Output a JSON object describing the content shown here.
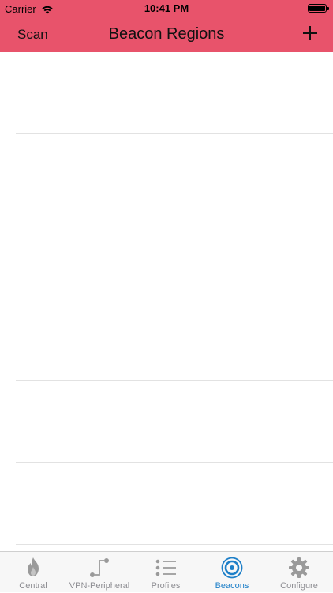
{
  "status_bar": {
    "carrier": "Carrier",
    "time": "10:41 PM"
  },
  "nav": {
    "left_label": "Scan",
    "title": "Beacon Regions",
    "right_icon": "plus-icon"
  },
  "colors": {
    "header": "#e8536b",
    "tab_active": "#1d7fc8",
    "tab_inactive": "#8e8e93"
  },
  "table": {
    "row_count": 6
  },
  "tabs": [
    {
      "label": "Central",
      "icon": "flame-icon",
      "active": false
    },
    {
      "label": "VPN-Peripheral",
      "icon": "peripheral-icon",
      "active": false
    },
    {
      "label": "Profiles",
      "icon": "list-icon",
      "active": false
    },
    {
      "label": "Beacons",
      "icon": "beacon-icon",
      "active": true
    },
    {
      "label": "Configure",
      "icon": "gear-icon",
      "active": false
    }
  ]
}
